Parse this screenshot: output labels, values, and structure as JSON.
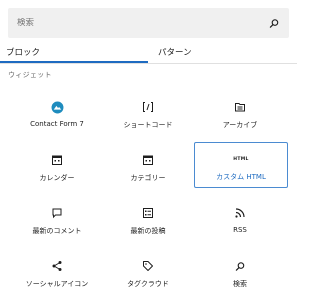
{
  "search": {
    "placeholder": "検索",
    "icon": "search-icon"
  },
  "tabs": [
    {
      "label": "ブロック",
      "active": true
    },
    {
      "label": "パターン",
      "active": false
    }
  ],
  "accent_color": "#1e6bc1",
  "section": {
    "title": "ウィジェット"
  },
  "blocks": [
    {
      "label": "Contact Form 7",
      "icon": "contact-form-7-icon"
    },
    {
      "label": "ショートコード",
      "icon": "shortcode-icon"
    },
    {
      "label": "アーカイブ",
      "icon": "archive-icon"
    },
    {
      "label": "カレンダー",
      "icon": "calendar-icon"
    },
    {
      "label": "カテゴリー",
      "icon": "categories-icon"
    },
    {
      "label": "カスタム HTML",
      "icon": "custom-html-icon",
      "selected": true,
      "icon_text": "HTML"
    },
    {
      "label": "最新のコメント",
      "icon": "latest-comments-icon"
    },
    {
      "label": "最新の投稿",
      "icon": "latest-posts-icon"
    },
    {
      "label": "RSS",
      "icon": "rss-icon"
    },
    {
      "label": "ソーシャルアイコン",
      "icon": "social-icons-icon"
    },
    {
      "label": "タグクラウド",
      "icon": "tag-cloud-icon"
    },
    {
      "label": "検索",
      "icon": "search-block-icon"
    }
  ]
}
